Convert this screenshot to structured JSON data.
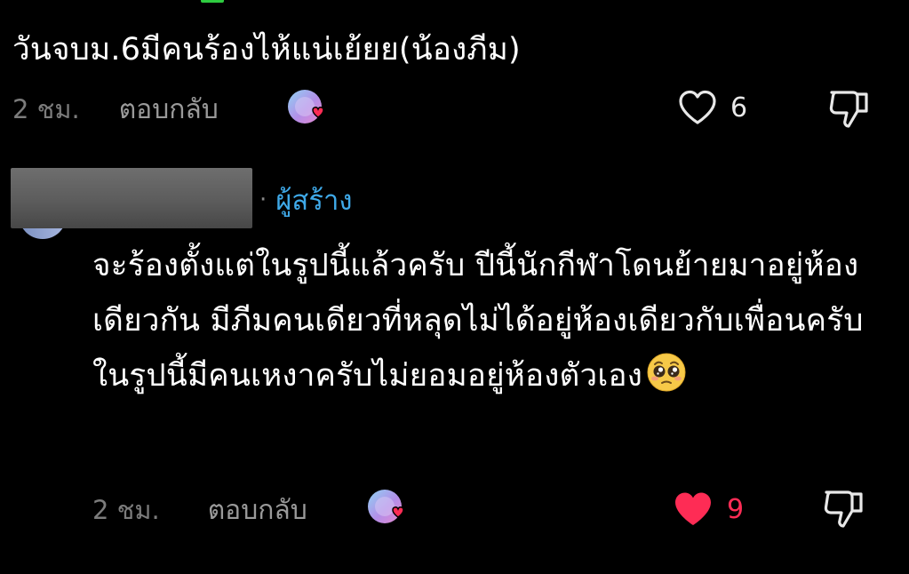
{
  "comments": [
    {
      "text": "วันจบม.6มีคนร้องไห้แน่เย้ยย(น้องภีม)",
      "time": "2 ชม.",
      "reply_label": "ตอบกลับ",
      "like_count": "6",
      "liked": false
    },
    {
      "author_badge": "ผู้สร้าง",
      "text": "จะร้องตั้งแต่ในรูปนี้แล้วครับ ปีนี้นักกีฬาโดนย้ายมาอยู่ห้องเดียวกัน มีภีมคนเดียวที่หลุดไม่ได้อยู่ห้องเดียวกับเพื่อนครับ ในรูปนี้มีคนเหงาครับไม่ยอมอยู่ห้องตัวเอง",
      "emoji": "pleading-face",
      "time": "2 ชม.",
      "reply_label": "ตอบกลับ",
      "like_count": "9",
      "liked": true
    }
  ],
  "colors": {
    "background": "#000000",
    "text": "#ffffff",
    "meta": "#7c7c7c",
    "author_badge": "#3fa9e8",
    "like_active": "#fe2c55"
  },
  "icons": {
    "like": "heart-outline-icon",
    "liked": "heart-filled-icon",
    "dislike": "thumbs-down-icon",
    "creator_reaction": "creator-liked-avatar-icon"
  }
}
